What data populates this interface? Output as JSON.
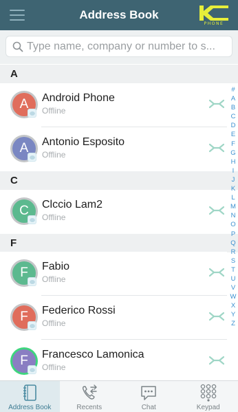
{
  "header": {
    "title": "Address Book",
    "logo_text": "PHONE",
    "menu_icon": "hamburger-icon",
    "logo_color": "#e6ee3a",
    "bar_color": "#3e6472"
  },
  "search": {
    "placeholder": "Type name, company or number to s..."
  },
  "sections": [
    {
      "letter": "A"
    },
    {
      "letter": "C"
    },
    {
      "letter": "F"
    }
  ],
  "contacts": [
    {
      "initial": "A",
      "name": "Android Phone",
      "status": "Offline",
      "avatar_color": "#e06d5c"
    },
    {
      "initial": "A",
      "name": "Antonio Esposito",
      "status": "Offline",
      "avatar_color": "#7a87c2"
    },
    {
      "initial": "C",
      "name": "Clccio Lam2",
      "status": "Offline",
      "avatar_color": "#5cb98f"
    },
    {
      "initial": "F",
      "name": "Fabio",
      "status": "Offline",
      "avatar_color": "#5cb98f"
    },
    {
      "initial": "F",
      "name": "Federico Rossi",
      "status": "Offline",
      "avatar_color": "#e06d5c"
    },
    {
      "initial": "F",
      "name": "Francesco Lamonica",
      "status": "Offline",
      "avatar_color": "#8a7ec2"
    }
  ],
  "alphabet": [
    "#",
    "A",
    "B",
    "C",
    "D",
    "E",
    "F",
    "G",
    "H",
    "I",
    "J",
    "K",
    "L",
    "M",
    "N",
    "O",
    "P",
    "Q",
    "R",
    "S",
    "T",
    "U",
    "V",
    "W",
    "X",
    "Y",
    "Z"
  ],
  "tabs": [
    {
      "label": "Address Book",
      "icon": "address-book-icon",
      "active": true
    },
    {
      "label": "Recents",
      "icon": "recents-phone-icon",
      "active": false
    },
    {
      "label": "Chat",
      "icon": "chat-bubble-icon",
      "active": false
    },
    {
      "label": "Keypad",
      "icon": "keypad-icon",
      "active": false
    }
  ],
  "colors": {
    "accent": "#3a8fd0",
    "call_icon": "#9fd6c6",
    "online_ring": "#3fd57e"
  }
}
